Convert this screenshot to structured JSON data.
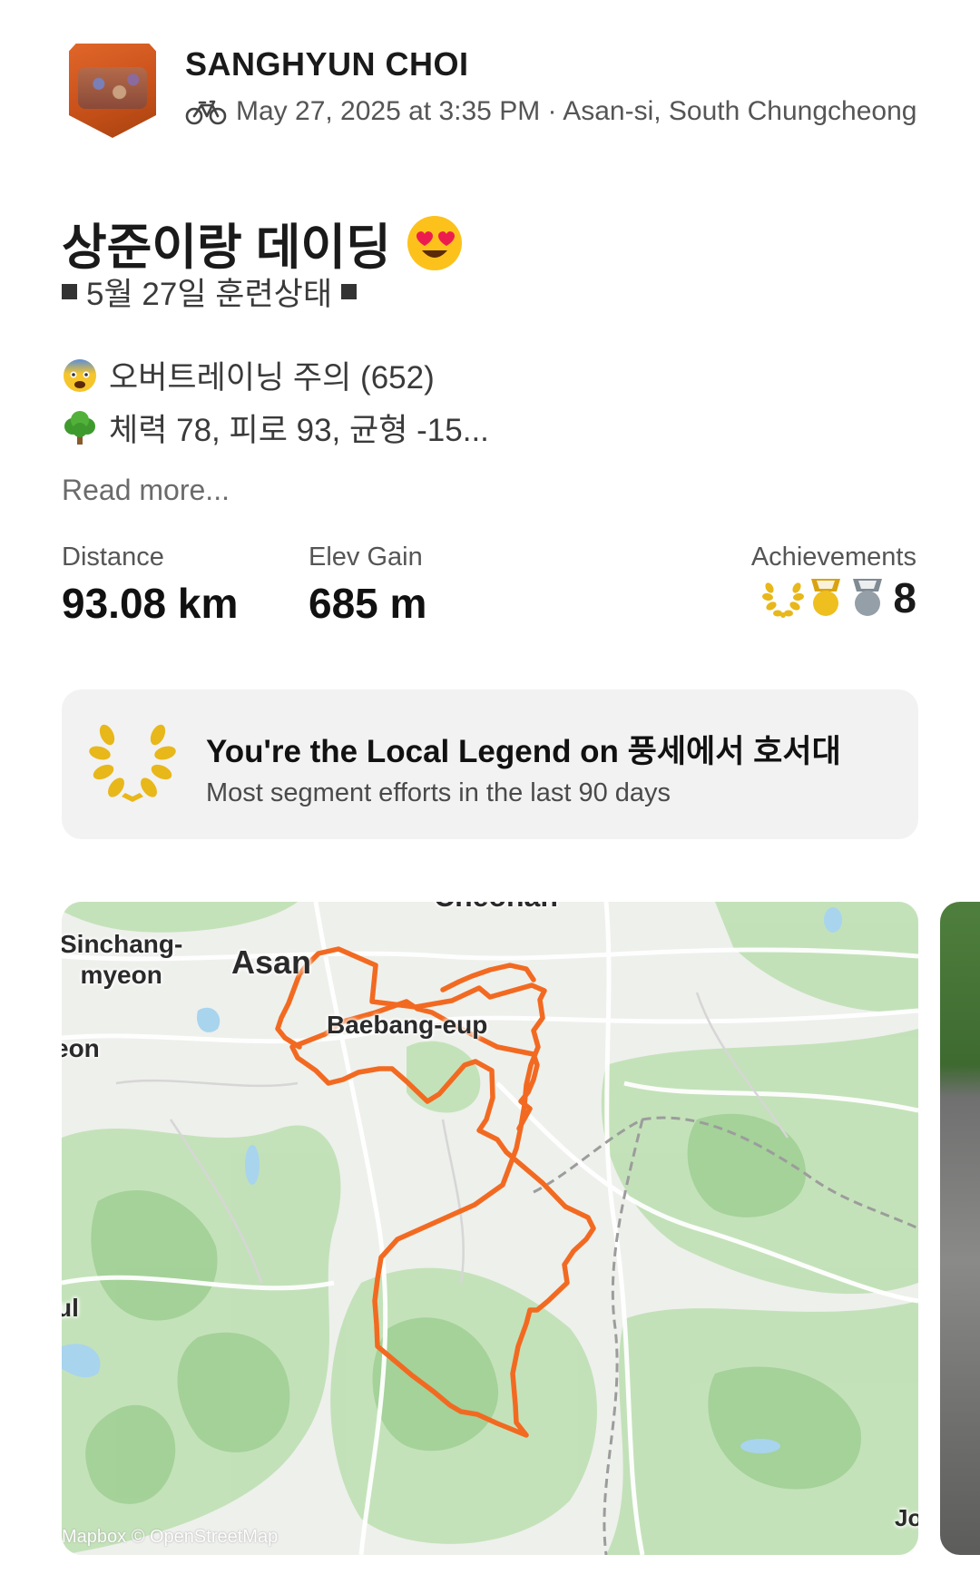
{
  "activity": {
    "athlete_name": "SANGHYUN CHOI",
    "meta": "May 27, 2025 at 3:35 PM · Asan-si, South Chungcheong",
    "sport_icon": "bike-icon",
    "title": "상준이랑 데이딩",
    "title_emoji": "heart-eyes-emoji"
  },
  "description": {
    "line1": "5월 27일 훈련상태",
    "line2": "오버트레이닝 주의 (652)",
    "line2_icon": "fearful-face-emoji",
    "line3": "체력 78, 피로 93, 균형 -15...",
    "line3_icon": "tree-emoji",
    "read_more": "Read more..."
  },
  "stats": {
    "distance_label": "Distance",
    "distance_value": "93.08 km",
    "elev_label": "Elev Gain",
    "elev_value": "685 m",
    "achievements_label": "Achievements",
    "achievements_count": "8",
    "achievement_icons": [
      "laurel-icon",
      "gold-medal-icon",
      "silver-medal-icon"
    ]
  },
  "local_legend": {
    "title": "You're the Local Legend on 풍세에서 호서대",
    "subtitle": "Most segment efforts in the last 90 days",
    "icon": "laurel-icon"
  },
  "map": {
    "labels": {
      "top": "Cheonan",
      "sinchang": "Sinchang-\nmyeon",
      "sinchang_line1": "Sinchang-",
      "sinchang_line2": "myeon",
      "asan": "Asan",
      "baebang": "Baebang-eup",
      "left_eon": "eon",
      "left_ul": "ul",
      "right_jo": "Jo"
    },
    "attribution": "Mapbox © OpenStreetMap",
    "route_color": "#f26a21"
  },
  "colors": {
    "accent": "#fc4c02",
    "gold": "#e8b71a",
    "silver": "#8f9aa3"
  }
}
